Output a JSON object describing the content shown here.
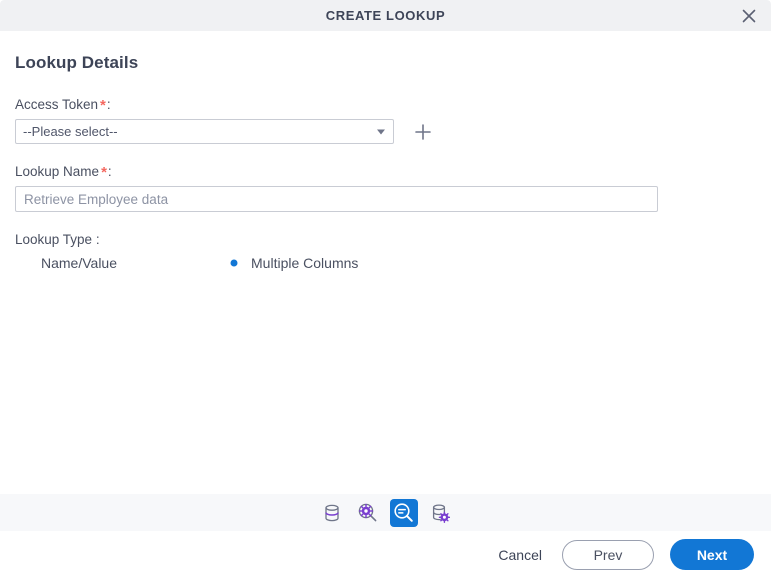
{
  "dialog": {
    "title": "CREATE LOOKUP",
    "close_icon": "close-icon"
  },
  "form": {
    "section_title": "Lookup Details",
    "access_token": {
      "label": "Access Token",
      "required_mark": "*",
      "colon": ":",
      "selected_value": "--Please select--",
      "options": [
        "--Please select--"
      ],
      "add_icon": "plus-icon"
    },
    "lookup_name": {
      "label": "Lookup Name",
      "required_mark": "*",
      "colon": ":",
      "value": "",
      "placeholder": "Retrieve Employee data"
    },
    "lookup_type": {
      "label": "Lookup Type :",
      "options": [
        {
          "label": "Name/Value",
          "selected": false
        },
        {
          "label": "Multiple Columns",
          "selected": true
        }
      ]
    }
  },
  "toolbar": {
    "icons": [
      {
        "name": "database-icon",
        "active": false
      },
      {
        "name": "search-settings-icon",
        "active": false
      },
      {
        "name": "lookup-search-icon",
        "active": true
      },
      {
        "name": "database-settings-icon",
        "active": false
      }
    ]
  },
  "footer": {
    "cancel_label": "Cancel",
    "prev_label": "Prev",
    "next_label": "Next"
  },
  "colors": {
    "accent_blue": "#1277d5",
    "required_red": "#f4685f",
    "icon_purple": "#7a3fd0",
    "icon_gray": "#6f7589",
    "titlebar_bg": "#f0f1f3",
    "toolbar_bg": "#f7f8fa"
  }
}
